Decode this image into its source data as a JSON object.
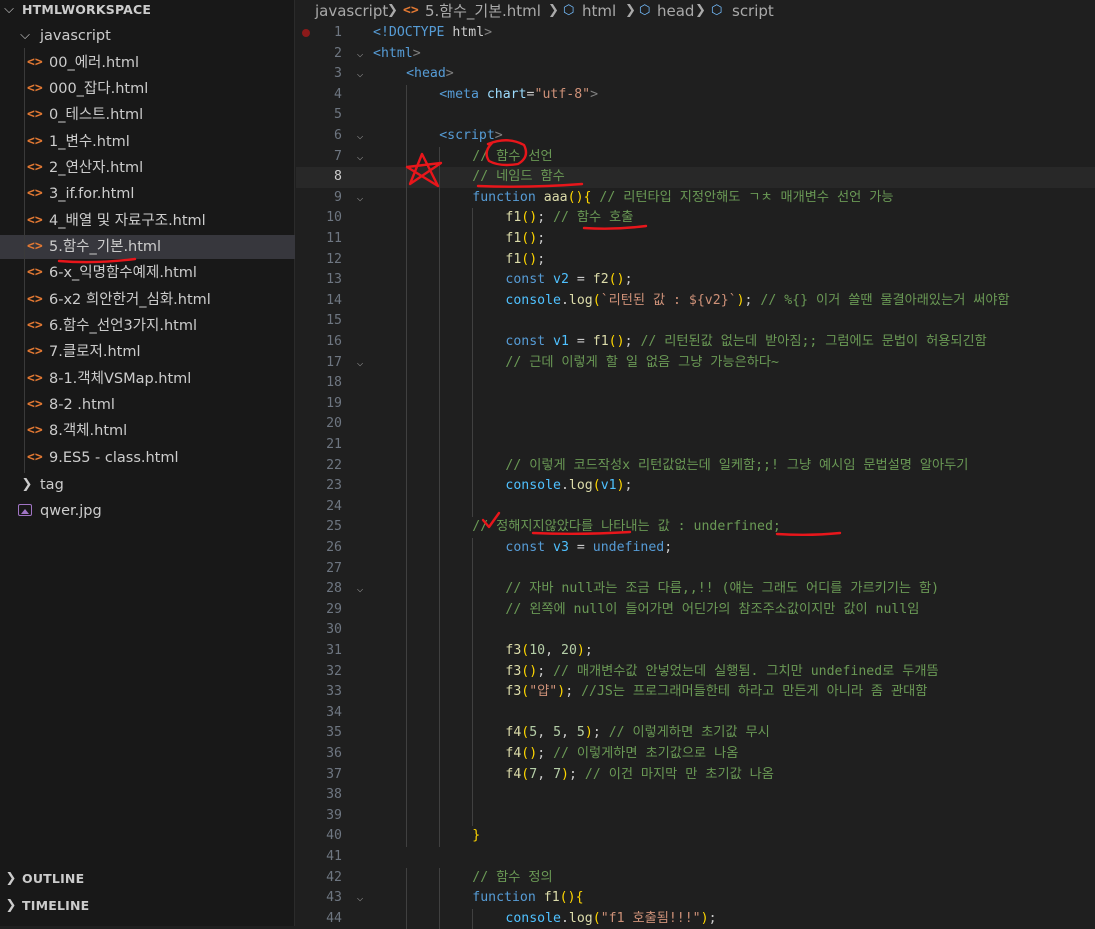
{
  "explorer": {
    "root": "HTMLWORKSPACE",
    "folder": "javascript",
    "files": [
      "00_에러.html",
      "000_잡다.html",
      "0_테스트.html",
      "1_변수.html",
      "2_연산자.html",
      "3_if.for.html",
      "4_배열 및 자료구조.html",
      "5.함수_기본.html",
      "6-x_익명함수예제.html",
      "6-x2 희안한거_심화.html",
      "6.함수_선언3가지.html",
      "7.클로저.html",
      "8-1.객체VSMap.html",
      "8-2 .html",
      "8.객체.html",
      "9.ES5 - class.html"
    ],
    "selected_file": "5.함수_기본.html",
    "tag_folder": "tag",
    "image_file": "qwer.jpg",
    "outline": "OUTLINE",
    "timeline": "TIMELINE"
  },
  "breadcrumb": {
    "folder": "javascript",
    "file": "5.함수_기본.html",
    "html": "html",
    "head": "head",
    "script": "script"
  },
  "editor": {
    "current_line": 8,
    "line_numbers": [
      "1",
      "2",
      "3",
      "4",
      "5",
      "6",
      "7",
      "8",
      "9",
      "10",
      "11",
      "12",
      "13",
      "14",
      "15",
      "16",
      "17",
      "18",
      "19",
      "20",
      "21",
      "22",
      "23",
      "24",
      "25",
      "26",
      "27",
      "28",
      "29",
      "30",
      "31",
      "32",
      "33",
      "34",
      "35",
      "36",
      "37",
      "38",
      "39",
      "40",
      "41",
      "42",
      "43",
      "44"
    ],
    "lines": [
      "<!DOCTYPE html>",
      "<html>",
      "<head>",
      "<meta chart=\"utf-8\">",
      "",
      "<script>",
      "// 함수 선언",
      "// 네임드 함수",
      "function aaa(){ // 리턴타입 지정안해도 ㄱㅊ 매개변수 선언 가능",
      "f1(); // 함수 호출",
      "f1();",
      "f1();",
      "const v2 = f2();",
      "console.log(`리턴된 값 : ${v2}`); // %{} 이거 쓸땐 물결아래있는거 써야함",
      "",
      "const v1 = f1(); // 리턴된값 없는데 받아짐;; 그럼에도 문법이 허용되긴함",
      "// 근데 이렇게 할 일 없음 그냥 가능은하다~",
      "",
      "",
      "",
      "",
      "// 이렇게 코드작성x 리턴값없는데 일케함;;! 그냥 예시임 문법설명 알아두기",
      "console.log(v1);",
      "",
      "// 정해지지않았다를 나타내는 값 : underfined;",
      "const v3 = undefined;",
      "",
      "// 자바 null과는 조금 다름,,!! (얘는 그래도 어디를 가르키기는 함)",
      "// 왼쪽에 null이 들어가면 어딘가의 참조주소값이지만 값이 null임",
      "",
      "f3(10, 20);",
      "f3(); // 매개변수값 안넣었는데 실행됨. 그치만 undefined로 두개뜸",
      "f3(\"얍\"); //JS는 프로그래머들한테 하라고 만든게 아니라 좀 관대함",
      "",
      "f4(5, 5, 5); // 이렇게하면 초기값 무시",
      "f4(); // 이렇게하면 초기값으로 나옴",
      "f4(7, 7); // 이건 마지막 만 초기값 나옴",
      "",
      "",
      "}",
      "",
      "// 함수 정의",
      "function f1(){",
      "console.log(\"f1 호출됨!!!\");"
    ]
  },
  "colors": {
    "comment": "#6a9955",
    "keyword": "#569cd6",
    "function": "#dcdcaa",
    "string": "#ce9178",
    "number": "#b5cea8",
    "variable": "#4fc1ff",
    "annotation": "#e8161b"
  }
}
